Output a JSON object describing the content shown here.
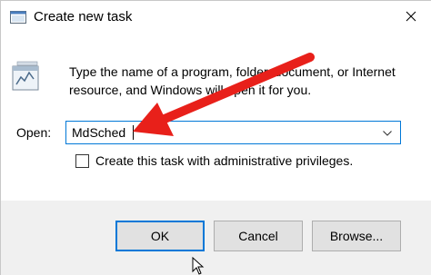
{
  "window": {
    "title": "Create new task",
    "close_glyph": "✕"
  },
  "content": {
    "description": "Type the name of a program, folder, document, or Internet resource, and Windows will open it for you.",
    "open_label": "Open:",
    "open_value": "MdSched",
    "admin_label": "Create this task with administrative privileges.",
    "admin_checked": false
  },
  "buttons": {
    "ok": "OK",
    "cancel": "Cancel",
    "browse": "Browse..."
  },
  "icons": {
    "title": "run-dialog-icon",
    "program": "run-program-icon",
    "dropdown": "chevron-down-icon",
    "annotation": "red-arrow-annotation",
    "pointer": "mouse-pointer-icon"
  },
  "colors": {
    "accent": "#0078d7",
    "annotation_red": "#e8201a",
    "footer_bg": "#f0f0f0"
  }
}
